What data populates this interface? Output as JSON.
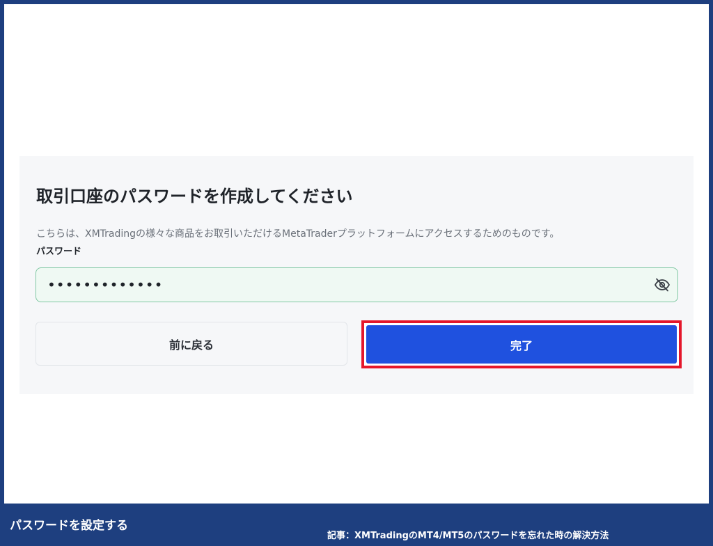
{
  "form": {
    "title": "取引口座のパスワードを作成してください",
    "description": "こちらは、XMTradingの様々な商品をお取引いただけるMetaTraderプラットフォームにアクセスするためのものです。",
    "password_label": "パスワード",
    "password_value": "•••••••••••••",
    "visibility_icon": "eye-off-icon",
    "back_label": "前に戻る",
    "done_label": "完了"
  },
  "caption": {
    "left": "パスワードを設定する",
    "right": "記事：XMTradingのMT4/MT5のパスワードを忘れた時の解決方法"
  },
  "colors": {
    "frame": "#1e3f7f",
    "primary_button": "#1f51df",
    "highlight": "#e4172b",
    "field_border": "#7fc7a2"
  }
}
